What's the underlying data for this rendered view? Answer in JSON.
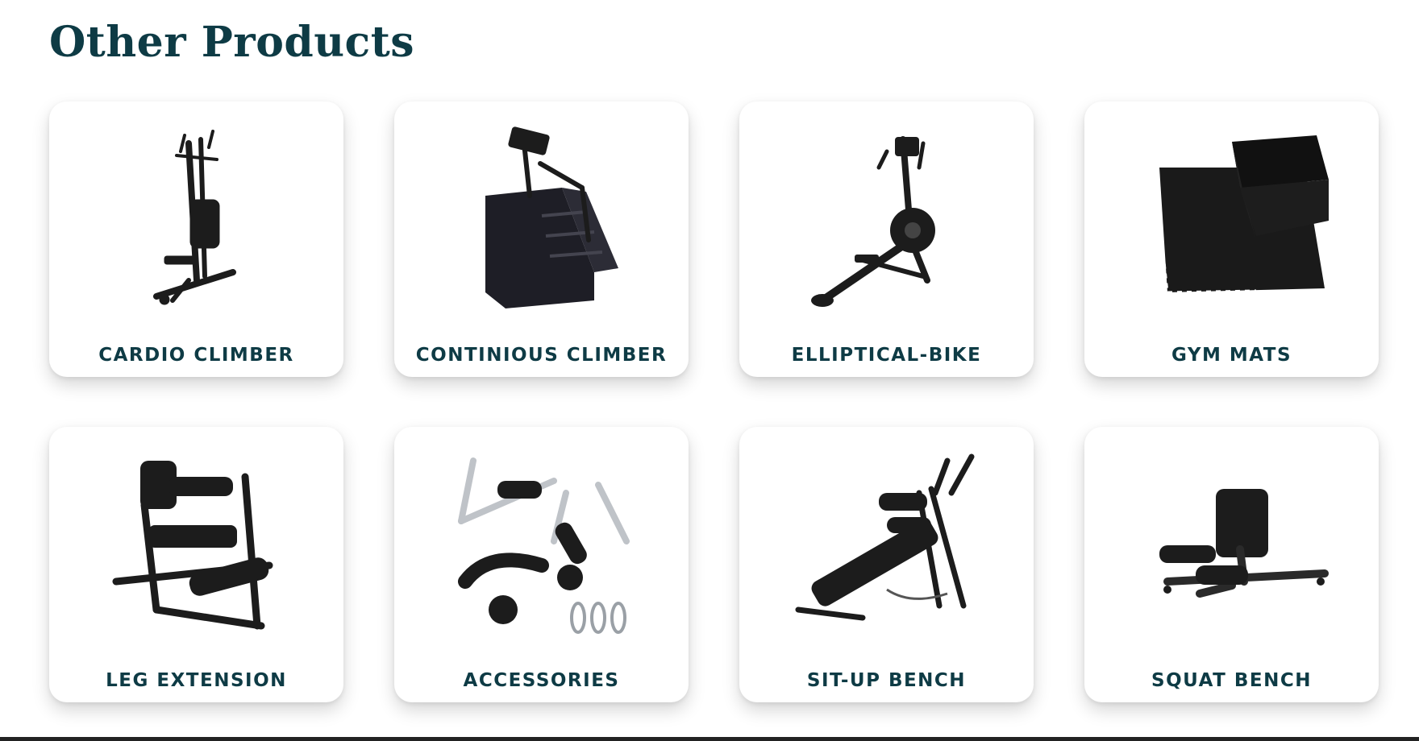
{
  "section": {
    "title": "Other Products"
  },
  "products": [
    {
      "label": "CARDIO CLIMBER",
      "icon": "cardio-climber-icon"
    },
    {
      "label": "CONTINIOUS CLIMBER",
      "icon": "stair-climber-icon"
    },
    {
      "label": "ELLIPTICAL-BIKE",
      "icon": "elliptical-bike-icon"
    },
    {
      "label": "GYM MATS",
      "icon": "gym-mats-icon"
    },
    {
      "label": "LEG EXTENSION",
      "icon": "leg-extension-icon"
    },
    {
      "label": "ACCESSORIES",
      "icon": "accessories-icon"
    },
    {
      "label": "SIT-UP BENCH",
      "icon": "sit-up-bench-icon"
    },
    {
      "label": "SQUAT BENCH",
      "icon": "squat-bench-icon"
    }
  ],
  "colors": {
    "heading": "#0e3b45",
    "card_bg": "#ffffff",
    "equipment": "#1c1c1c"
  }
}
